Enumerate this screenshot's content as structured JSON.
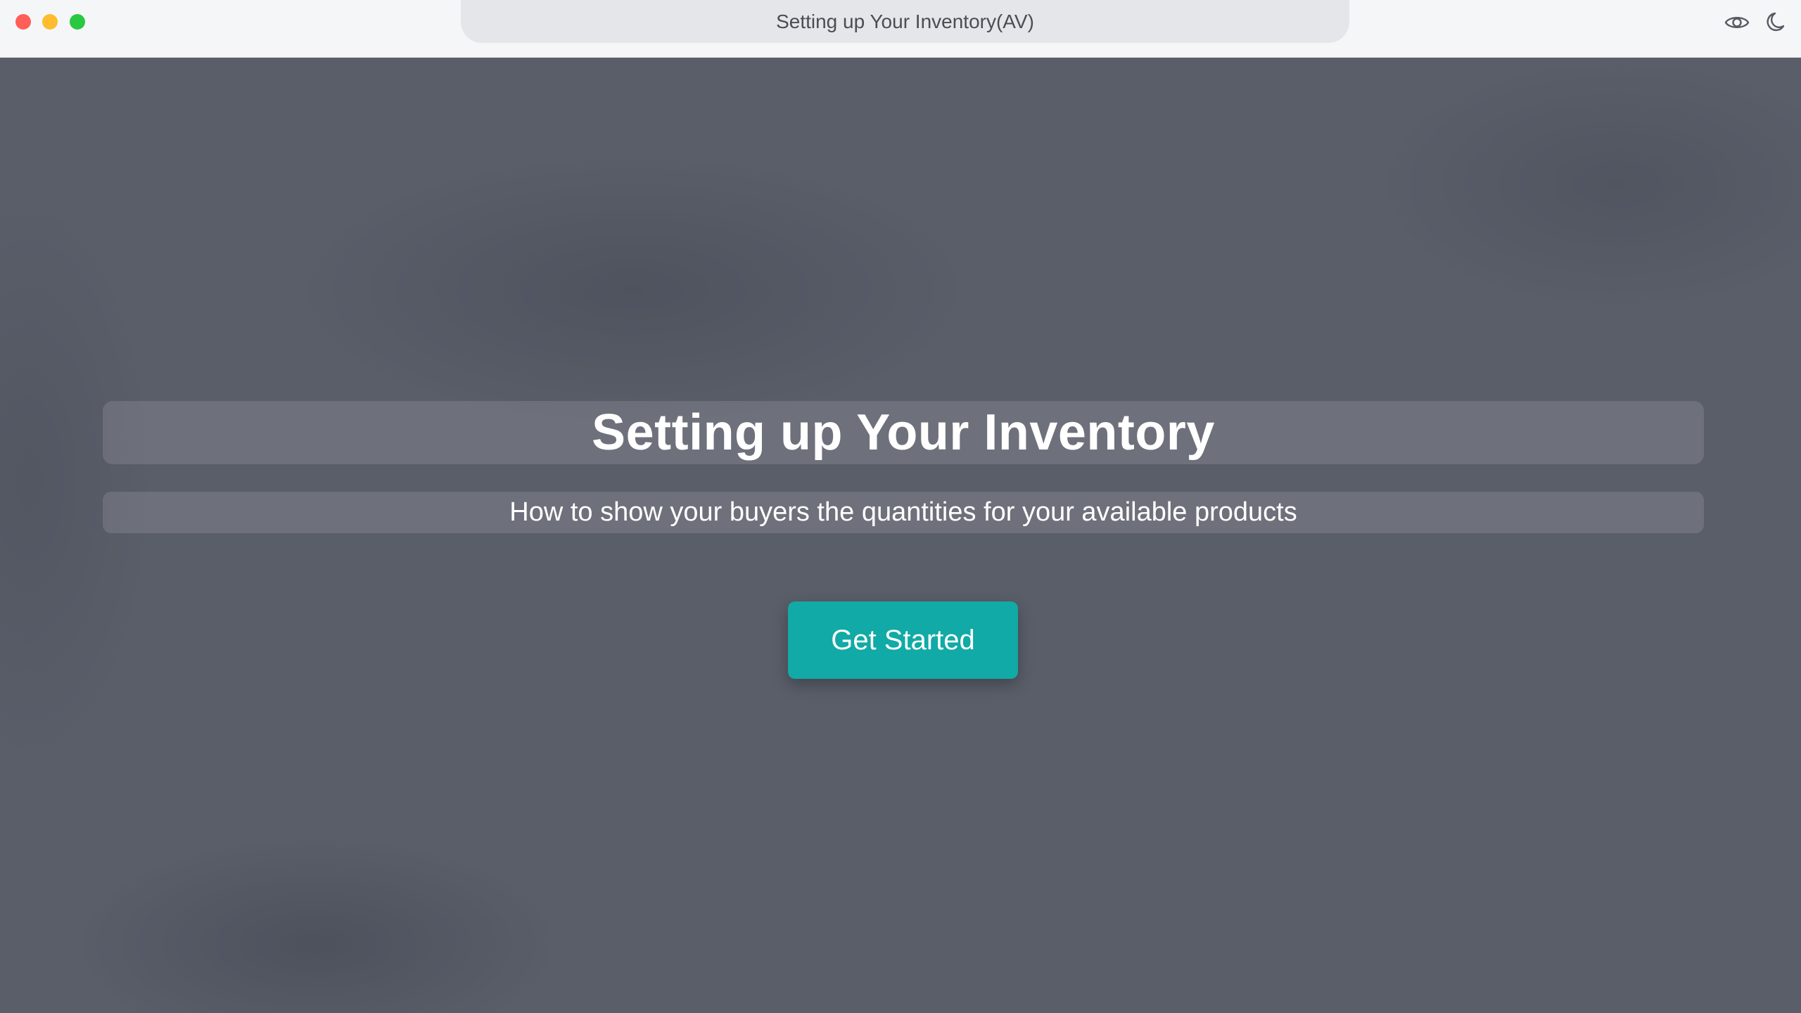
{
  "window": {
    "address_title": "Setting up Your Inventory(AV)"
  },
  "toolbar": {
    "icons": [
      "eye-icon",
      "moon-icon"
    ]
  },
  "hero": {
    "title": "Setting up Your Inventory",
    "subtitle": "How to show your buyers the quantities for your available products",
    "cta_label": "Get Started"
  },
  "colors": {
    "accent": "#11aaa6",
    "background": "#5a5e69",
    "titlebar": "#f5f6f7",
    "close": "#ff5f57",
    "minimize": "#febc2e",
    "maximize": "#28c840"
  }
}
